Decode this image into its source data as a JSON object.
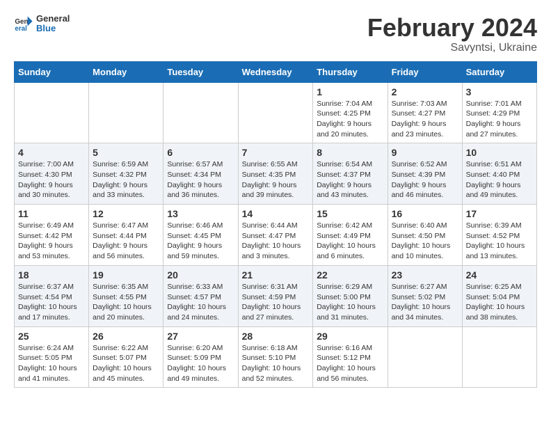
{
  "logo": {
    "text_general": "General",
    "text_blue": "Blue"
  },
  "header": {
    "title": "February 2024",
    "subtitle": "Savyntsi, Ukraine"
  },
  "columns": [
    "Sunday",
    "Monday",
    "Tuesday",
    "Wednesday",
    "Thursday",
    "Friday",
    "Saturday"
  ],
  "weeks": [
    [
      {
        "day": "",
        "info": ""
      },
      {
        "day": "",
        "info": ""
      },
      {
        "day": "",
        "info": ""
      },
      {
        "day": "",
        "info": ""
      },
      {
        "day": "1",
        "info": "Sunrise: 7:04 AM\nSunset: 4:25 PM\nDaylight: 9 hours\nand 20 minutes."
      },
      {
        "day": "2",
        "info": "Sunrise: 7:03 AM\nSunset: 4:27 PM\nDaylight: 9 hours\nand 23 minutes."
      },
      {
        "day": "3",
        "info": "Sunrise: 7:01 AM\nSunset: 4:29 PM\nDaylight: 9 hours\nand 27 minutes."
      }
    ],
    [
      {
        "day": "4",
        "info": "Sunrise: 7:00 AM\nSunset: 4:30 PM\nDaylight: 9 hours\nand 30 minutes."
      },
      {
        "day": "5",
        "info": "Sunrise: 6:59 AM\nSunset: 4:32 PM\nDaylight: 9 hours\nand 33 minutes."
      },
      {
        "day": "6",
        "info": "Sunrise: 6:57 AM\nSunset: 4:34 PM\nDaylight: 9 hours\nand 36 minutes."
      },
      {
        "day": "7",
        "info": "Sunrise: 6:55 AM\nSunset: 4:35 PM\nDaylight: 9 hours\nand 39 minutes."
      },
      {
        "day": "8",
        "info": "Sunrise: 6:54 AM\nSunset: 4:37 PM\nDaylight: 9 hours\nand 43 minutes."
      },
      {
        "day": "9",
        "info": "Sunrise: 6:52 AM\nSunset: 4:39 PM\nDaylight: 9 hours\nand 46 minutes."
      },
      {
        "day": "10",
        "info": "Sunrise: 6:51 AM\nSunset: 4:40 PM\nDaylight: 9 hours\nand 49 minutes."
      }
    ],
    [
      {
        "day": "11",
        "info": "Sunrise: 6:49 AM\nSunset: 4:42 PM\nDaylight: 9 hours\nand 53 minutes."
      },
      {
        "day": "12",
        "info": "Sunrise: 6:47 AM\nSunset: 4:44 PM\nDaylight: 9 hours\nand 56 minutes."
      },
      {
        "day": "13",
        "info": "Sunrise: 6:46 AM\nSunset: 4:45 PM\nDaylight: 9 hours\nand 59 minutes."
      },
      {
        "day": "14",
        "info": "Sunrise: 6:44 AM\nSunset: 4:47 PM\nDaylight: 10 hours\nand 3 minutes."
      },
      {
        "day": "15",
        "info": "Sunrise: 6:42 AM\nSunset: 4:49 PM\nDaylight: 10 hours\nand 6 minutes."
      },
      {
        "day": "16",
        "info": "Sunrise: 6:40 AM\nSunset: 4:50 PM\nDaylight: 10 hours\nand 10 minutes."
      },
      {
        "day": "17",
        "info": "Sunrise: 6:39 AM\nSunset: 4:52 PM\nDaylight: 10 hours\nand 13 minutes."
      }
    ],
    [
      {
        "day": "18",
        "info": "Sunrise: 6:37 AM\nSunset: 4:54 PM\nDaylight: 10 hours\nand 17 minutes."
      },
      {
        "day": "19",
        "info": "Sunrise: 6:35 AM\nSunset: 4:55 PM\nDaylight: 10 hours\nand 20 minutes."
      },
      {
        "day": "20",
        "info": "Sunrise: 6:33 AM\nSunset: 4:57 PM\nDaylight: 10 hours\nand 24 minutes."
      },
      {
        "day": "21",
        "info": "Sunrise: 6:31 AM\nSunset: 4:59 PM\nDaylight: 10 hours\nand 27 minutes."
      },
      {
        "day": "22",
        "info": "Sunrise: 6:29 AM\nSunset: 5:00 PM\nDaylight: 10 hours\nand 31 minutes."
      },
      {
        "day": "23",
        "info": "Sunrise: 6:27 AM\nSunset: 5:02 PM\nDaylight: 10 hours\nand 34 minutes."
      },
      {
        "day": "24",
        "info": "Sunrise: 6:25 AM\nSunset: 5:04 PM\nDaylight: 10 hours\nand 38 minutes."
      }
    ],
    [
      {
        "day": "25",
        "info": "Sunrise: 6:24 AM\nSunset: 5:05 PM\nDaylight: 10 hours\nand 41 minutes."
      },
      {
        "day": "26",
        "info": "Sunrise: 6:22 AM\nSunset: 5:07 PM\nDaylight: 10 hours\nand 45 minutes."
      },
      {
        "day": "27",
        "info": "Sunrise: 6:20 AM\nSunset: 5:09 PM\nDaylight: 10 hours\nand 49 minutes."
      },
      {
        "day": "28",
        "info": "Sunrise: 6:18 AM\nSunset: 5:10 PM\nDaylight: 10 hours\nand 52 minutes."
      },
      {
        "day": "29",
        "info": "Sunrise: 6:16 AM\nSunset: 5:12 PM\nDaylight: 10 hours\nand 56 minutes."
      },
      {
        "day": "",
        "info": ""
      },
      {
        "day": "",
        "info": ""
      }
    ]
  ]
}
